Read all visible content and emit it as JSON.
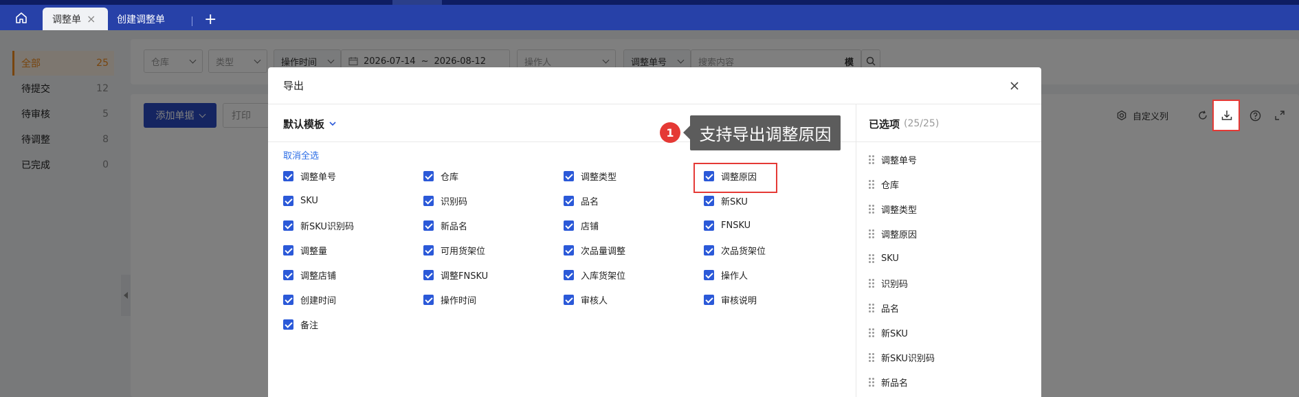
{
  "tabs": {
    "active_label": "调整单",
    "second_label": "创建调整单",
    "close_glyph": "×",
    "add_glyph": "+"
  },
  "status_list": [
    {
      "label": "全部",
      "count": "25"
    },
    {
      "label": "待提交",
      "count": "12"
    },
    {
      "label": "待审核",
      "count": "5"
    },
    {
      "label": "待调整",
      "count": "8"
    },
    {
      "label": "已完成",
      "count": "0"
    }
  ],
  "filters": {
    "warehouse": "仓库",
    "type": "类型",
    "time_type": "操作时间",
    "date_from": "2026-07-14",
    "date_sep": "~",
    "date_to": "2026-08-12",
    "operator": "操作人",
    "search_field": "调整单号",
    "search_placeholder": "搜索内容",
    "mode_label": "模"
  },
  "toolbar": {
    "add_label": "添加单据",
    "print_label": "打印",
    "custom_columns_label": "自定义列"
  },
  "modal": {
    "title": "导出",
    "template_label": "默认模板",
    "deselect_all": "取消全选",
    "fields": [
      "调整单号",
      "仓库",
      "调整类型",
      "调整原因",
      "SKU",
      "识别码",
      "品名",
      "新SKU",
      "新SKU识别码",
      "新品名",
      "店铺",
      "FNSKU",
      "调整量",
      "可用货架位",
      "次品量调整",
      "次品货架位",
      "调整店铺",
      "调整FNSKU",
      "入库货架位",
      "操作人",
      "创建时间",
      "操作时间",
      "审核人",
      "审核说明",
      "备注"
    ],
    "selected_title": "已选项",
    "selected_count": "(25/25)",
    "selected_items": [
      "调整单号",
      "仓库",
      "调整类型",
      "调整原因",
      "SKU",
      "识别码",
      "品名",
      "新SKU",
      "新SKU识别码",
      "新品名"
    ]
  },
  "annotation": {
    "badge": "1",
    "text": "支持导出调整原因",
    "color": "#e53935"
  },
  "colors": {
    "tabbar": "#2741a8",
    "primary": "#2b4bc2",
    "checkbox": "#2b59d8",
    "active_status": "#f08a1c"
  }
}
